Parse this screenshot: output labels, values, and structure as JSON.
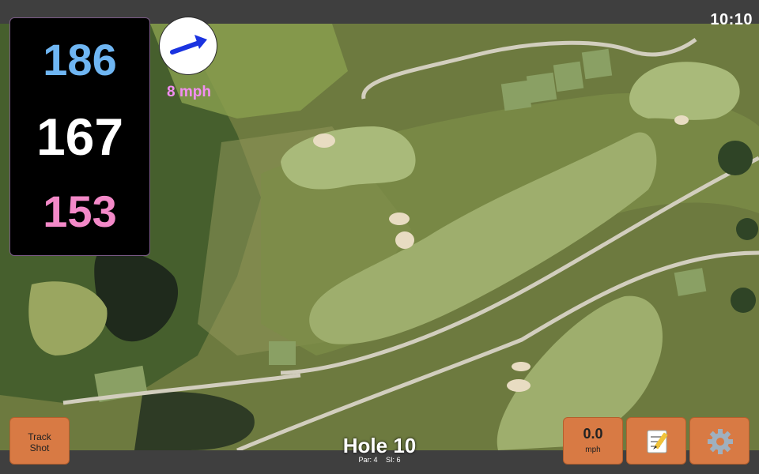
{
  "status": {
    "time": "10:10"
  },
  "distances": {
    "back": "186",
    "middle": "167",
    "front": "153"
  },
  "wind": {
    "speed_label": "8 mph",
    "direction_icon": "wind-arrow-icon"
  },
  "buttons": {
    "track_shot_line1": "Track",
    "track_shot_line2": "Shot",
    "wind_value": "0.0",
    "wind_unit": "mph",
    "notes_icon": "notepad-icon",
    "settings_icon": "gear-icon"
  },
  "hole": {
    "title": "Hole 10",
    "par": "Par: 4",
    "si": "SI: 6"
  },
  "colors": {
    "back_distance": "#6fb6f3",
    "middle_distance": "#ffffff",
    "front_distance": "#f389c8",
    "wind_label": "#f38ef2",
    "button_bg": "#d87a44",
    "wind_arrow": "#1a33e0"
  }
}
